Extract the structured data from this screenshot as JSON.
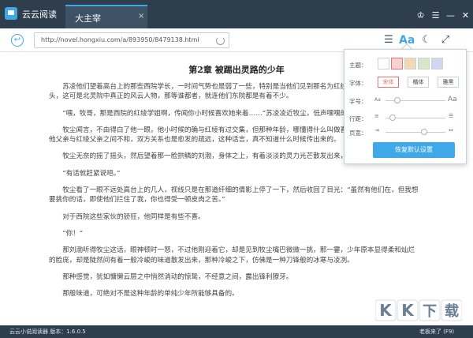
{
  "app": {
    "title": "云云阅读"
  },
  "tab": {
    "label": "大主宰",
    "close": "×"
  },
  "window_controls": {
    "skin": "♔",
    "menu": "☰",
    "minimize": "—",
    "close": "✕"
  },
  "toolbar": {
    "back_icon": "↩",
    "url": "http://novel.hongxiu.com/a/893950/8479138.html",
    "list_icon": "☰",
    "font_icon": "Aa",
    "moon_icon": "☾",
    "fullscreen_icon": "⤢"
  },
  "chapter": {
    "title": "第2章 被踢出灵路的少年",
    "paragraphs": [
      "苏凌他们望着高台上的那些西院学长，一时间气势也是弱了一些，特别是当他们见到那名为红线的少年，然后又是缩缩头，这可是北灵院中真正的风云人物，那等谁都者，就连他们东院都是有着不少。",
      "“喂，牧哥，那是西院的红绫学姐啊，传闻你小时候喜欢她来着……”苏凌凌近牧尘，低声嘿嘿的笑道。",
      "牧尘闻言，不由得白了他一眼，他小时候的确与红绫有过交集，但那种年龄，哪懂得什么叫做喜欢，而已，这些年随着他父亲与红绫父亲之间不和，双方关系也是愈发的疏远，这种话言，真不知道什么时候传出来的。",
      "牧尘无奈的摇了摇头，然后望着那一脸拱鳞的刘渤，身体之上，有着淡淡的灵力光芒散发出来，他对着这位前来，",
      "“有话就赶紧说吧。”",
      "牧尘看了一眼不远处高台上的几人，视线只是在那道纤细的倩影上停了一下，然后收回了目光：“虽然有他们在，但我想要挑你的话，即使他们拦住了我，你也得受一顿皮肉之苦。”",
      "对于西院这些家伙的骄狂，他同样是有些不喜。",
      "“你！”",
      "那刘渤听得牧尘这话，眼神顿时一怒，不过他刚迎着它，却是见到牧尘嘴巴微微一挑，那一霎，少年原本显得柔和灿烂的脸庞，却是陡然间有着一般冷峻的味道散发出来，那种冷峻之下，仿佛是一种刀锋般的冰寒与凌冽。",
      "那种感觉，犹如慵懒云层之中悄然淌动的惊鸷，不经意之间，露出锋利獠牙。",
      "那般味道，可绝对不是这种年龄的单纯少年所能够具备的。"
    ]
  },
  "settings": {
    "theme_label": "主题：",
    "font_label": "字体：",
    "size_label": "字号：",
    "line_label": "行距：",
    "page_label": "页宽：",
    "fonts": [
      "宋体",
      "楷体",
      "雅黑"
    ],
    "theme_colors": [
      "#ffffff",
      "#f4d2d0",
      "#f3d8b8",
      "#d6e6c6",
      "#cfd8ee"
    ],
    "size_small": "Aa",
    "size_large": "Aa",
    "size_level": 0.2,
    "line_level": 0.12,
    "page_level": 0.65,
    "reset_label": "恢复默认设置"
  },
  "statusbar": {
    "text": "云云小说阅读器 版本：1.6.0.5",
    "right": "老板来了 (F9)"
  },
  "watermark": {
    "text": "KK下载"
  },
  "colors": {
    "accent": "#3ea8e8",
    "dark": "#2f3e4d"
  }
}
